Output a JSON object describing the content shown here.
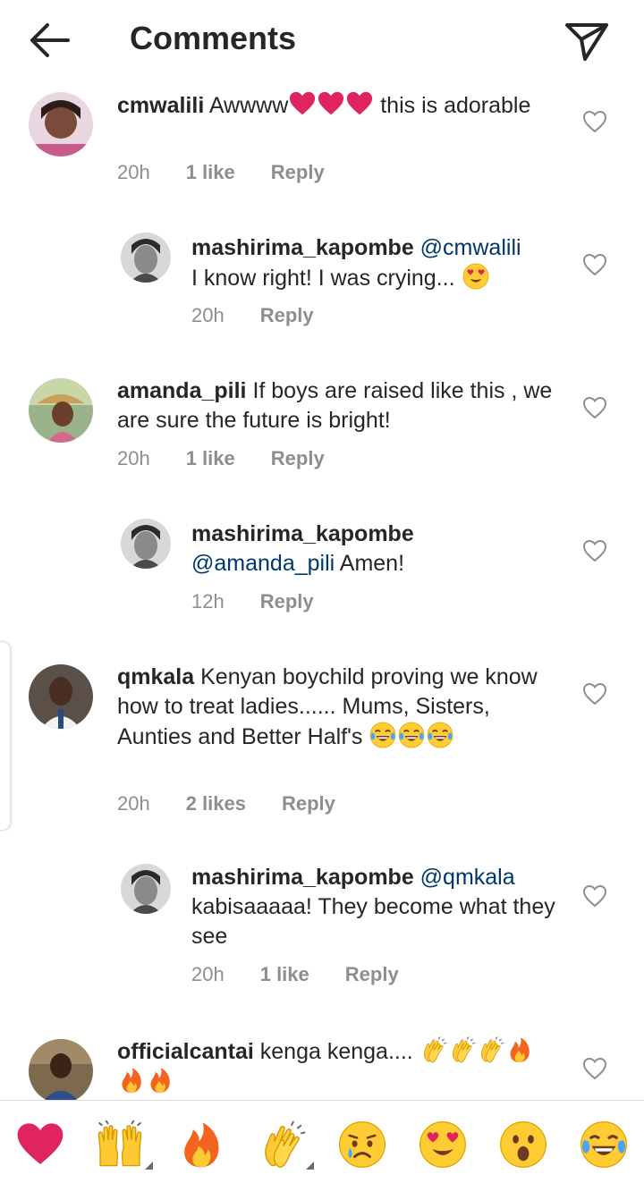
{
  "header": {
    "title": "Comments"
  },
  "comments": [
    {
      "username": "cmwalili",
      "text_before": " Awwww",
      "text_after": " this is adorable",
      "time": "20h",
      "likes": "1 like",
      "reply_label": "Reply"
    },
    {
      "username": "mashirima_kapombe",
      "mention": "@cmwalili",
      "text": "I know right! I was crying... ",
      "time": "20h",
      "reply_label": "Reply"
    },
    {
      "username": "amanda_pili",
      "text": " If boys are raised like this , we are sure the future is bright!",
      "time": "20h",
      "likes": "1 like",
      "reply_label": "Reply"
    },
    {
      "username": "mashirima_kapombe",
      "mention": "@amanda_pili",
      "text": " Amen!",
      "time": "12h",
      "reply_label": "Reply"
    },
    {
      "username": "qmkala",
      "text": " Kenyan boychild proving we know how to treat ladies...... Mums, Sisters, Aunties and Better Half's ",
      "time": "20h",
      "likes": "2 likes",
      "reply_label": "Reply"
    },
    {
      "username": "mashirima_kapombe",
      "mention": "@qmkala",
      "text": "kabisaaaaa! They become what they see",
      "time": "20h",
      "likes": "1 like",
      "reply_label": "Reply"
    },
    {
      "username": "officialcantai",
      "text": " kenga kenga.... "
    }
  ],
  "reactions": [
    "red-heart",
    "raising-hands",
    "fire",
    "clapping-hands",
    "crying-face",
    "heart-eyes-face",
    "astonished-face",
    "tears-of-joy-face"
  ],
  "colors": {
    "mention": "#00376b",
    "meta": "#8e8e8e",
    "heart": "#e0245e"
  }
}
